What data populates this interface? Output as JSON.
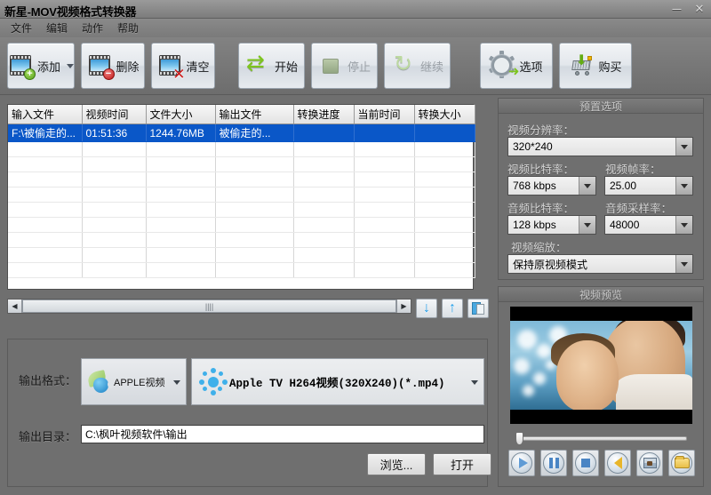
{
  "window": {
    "title": "新星-MOV视频格式转换器",
    "minimize_label": "—",
    "close_label": "✕"
  },
  "menubar": {
    "items": [
      {
        "label": "文件",
        "name": "menu-file"
      },
      {
        "label": "编辑",
        "name": "menu-edit"
      },
      {
        "label": "动作",
        "name": "menu-action"
      },
      {
        "label": "帮助",
        "name": "menu-help"
      }
    ]
  },
  "toolbar": {
    "add_label": "添加",
    "delete_label": "删除",
    "clear_label": "清空",
    "start_label": "开始",
    "stop_label": "停止",
    "continue_label": "继续",
    "options_label": "选项",
    "buy_label": "购买"
  },
  "filelist": {
    "columns": [
      "输入文件",
      "视频时间",
      "文件大小",
      "输出文件",
      "转换进度",
      "当前时间",
      "转换大小"
    ],
    "rows": [
      {
        "input_file": "F:\\被偷走的...",
        "video_time": "01:51:36",
        "file_size": "1244.76MB",
        "output_file": "被偷走的...",
        "progress": "",
        "current_time": "",
        "converted_size": "",
        "selected": true
      }
    ],
    "scrollbar": {
      "left_arrow": "◀",
      "right_arrow": "▶",
      "grip": "||||"
    },
    "tools": [
      {
        "name": "move-down-button",
        "glyph": "↓"
      },
      {
        "name": "move-up-button",
        "glyph": "↑"
      },
      {
        "name": "copy-button",
        "glyph": ""
      }
    ]
  },
  "output": {
    "format_label": "输出格式：",
    "format_category": "APPLE视频",
    "format_profile": "Apple TV H264视频(320X240)(*.mp4)",
    "directory_label": "输出目录：",
    "directory_value": "C:\\枫叶视频软件\\输出",
    "browse_label": "浏览...",
    "open_label": "打开"
  },
  "preset": {
    "title": "预置选项",
    "resolution_label": "视频分辨率：",
    "resolution_value": "320*240",
    "video_bitrate_label": "视频比特率：",
    "video_bitrate_value": "768 kbps",
    "frame_rate_label": "视频帧率：",
    "frame_rate_value": "25.00",
    "audio_bitrate_label": "音频比特率：",
    "audio_bitrate_value": "128 kbps",
    "sample_rate_label": "音频采样率：",
    "sample_rate_value": "48000",
    "scaling_label": "视频缩放：",
    "scaling_value": "保持原视频模式"
  },
  "preview": {
    "title": "视频预览",
    "controls": [
      {
        "name": "play-button"
      },
      {
        "name": "pause-button"
      },
      {
        "name": "stop-button"
      },
      {
        "name": "volume-button"
      },
      {
        "name": "snapshot-button"
      },
      {
        "name": "open-folder-button"
      }
    ]
  },
  "colors": {
    "window_bg": "#6f6f6f",
    "selection_blue": "#0a57c8",
    "accent_green": "#7dc41e",
    "accent_blue": "#3fb0ea"
  }
}
